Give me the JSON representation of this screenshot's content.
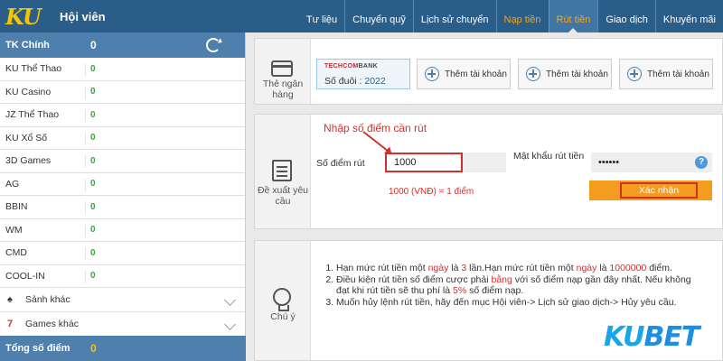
{
  "header": {
    "logo": "KU",
    "title": "Hội viên",
    "nav": [
      {
        "label": "Tư liệu",
        "state": "normal"
      },
      {
        "label": "Chuyển quỹ",
        "state": "normal"
      },
      {
        "label": "Lịch sử chuyển",
        "state": "normal"
      },
      {
        "label": "Nạp tiền",
        "state": "orange"
      },
      {
        "label": "Rút tiền",
        "state": "active"
      },
      {
        "label": "Giao dịch",
        "state": "normal"
      },
      {
        "label": "Khuyến mãi",
        "state": "normal"
      }
    ]
  },
  "sidebar": {
    "main": {
      "label": "TK Chính",
      "value": "0"
    },
    "items": [
      {
        "label": "KU Thể Thao",
        "value": "0"
      },
      {
        "label": "KU Casino",
        "value": "0"
      },
      {
        "label": "JZ Thể Thao",
        "value": "0"
      },
      {
        "label": "KU Xổ Số",
        "value": "0"
      },
      {
        "label": "3D Games",
        "value": "0"
      },
      {
        "label": "AG",
        "value": "0"
      },
      {
        "label": "BBIN",
        "value": "0"
      },
      {
        "label": "WM",
        "value": "0"
      },
      {
        "label": "CMD",
        "value": "0"
      },
      {
        "label": "COOL-IN",
        "value": "0"
      }
    ],
    "expanders": [
      {
        "icon": "♠",
        "label": "Sảnh khác"
      },
      {
        "icon": "7",
        "label": "Games khác"
      }
    ],
    "total": {
      "label": "Tổng số điểm",
      "value": "0"
    }
  },
  "bank_panel": {
    "side_label": "Thẻ ngân hàng",
    "bank": {
      "name_red": "TECHCOM",
      "name_dark": "BANK",
      "suffix_label": "Số đuôi :",
      "suffix_value": "2022"
    },
    "add_buttons": [
      "Thêm tài khoản",
      "Thêm tài khoản",
      "Thêm tài khoản"
    ]
  },
  "withdraw_panel": {
    "side_label": "Đề xuất yêu cầu",
    "annotation": "Nhập số điểm cần rút",
    "amount_label": "Số điểm rút",
    "amount_value": "1000",
    "password_label": "Mật khẩu rút tiền",
    "password_value": "••••••",
    "help": "?",
    "rate": "1000 (VNĐ) = 1 điểm",
    "confirm": "Xác nhận"
  },
  "notes_panel": {
    "side_label": "Chú ý",
    "notes": [
      {
        "a": "Hạn mức rút tiền một ",
        "b": "ngày",
        "c": " là ",
        "d": "3",
        "e": " lần.Hạn mức rút tiền một ",
        "f": "ngày",
        "g": " là ",
        "h": "1000000",
        "i": " điểm."
      },
      {
        "a": "Điều kiện rút tiền số điểm cược phải ",
        "b": "bằng",
        "c": " với số điểm nạp gần đây nhất. Nếu không đạt khi rút tiền sẽ thu phí là ",
        "d": "5%",
        "e": " số điểm nạp."
      },
      {
        "a": "Muốn hủy lệnh rút tiền, hãy đến mục Hội viên-> Lịch sử giao dịch-> Hủy yêu cầu."
      }
    ]
  },
  "watermark": {
    "k": "KU",
    "rest": "BET"
  },
  "colors": {
    "header": "#2a5d88",
    "sidebar_bar": "#4f80ad",
    "accent_orange": "#f39c1f",
    "annotation_red": "#d0312d",
    "value_green": "#3aa63a"
  }
}
